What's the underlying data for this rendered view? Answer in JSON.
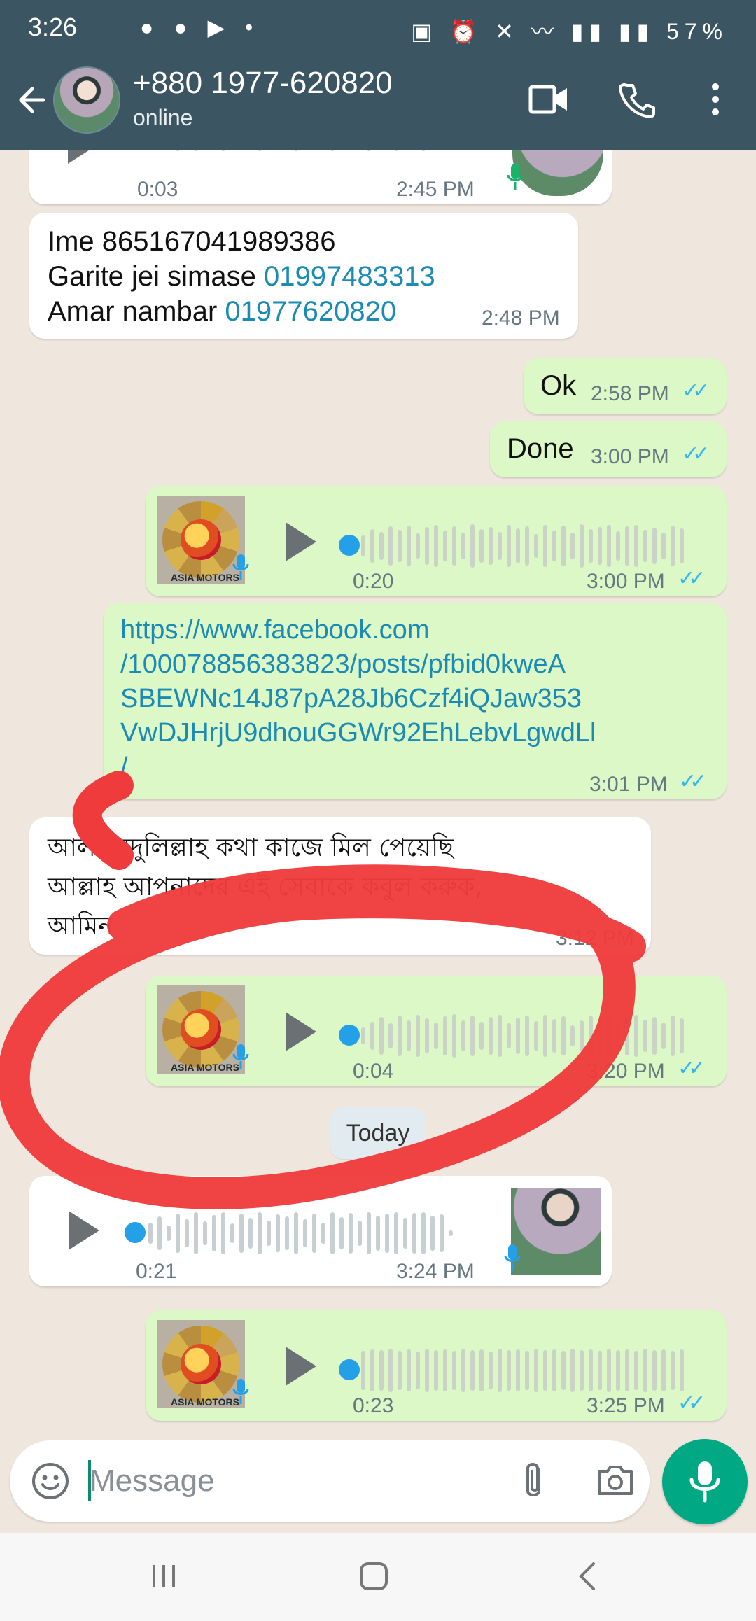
{
  "status_bar": {
    "time": "3:26",
    "battery": "57%"
  },
  "app_bar": {
    "contact_name": "+880 1977-620820",
    "status": "online",
    "icons": [
      "back-arrow-icon",
      "video-call-icon",
      "voice-call-icon",
      "more-options-icon"
    ]
  },
  "messages": {
    "m1_voice_in": {
      "duration": "0:03",
      "time": "2:45 PM"
    },
    "m2_text_in": {
      "line1": "Ime 865167041989386",
      "line2_prefix": "Garite jei simase ",
      "line2_link": "01997483313",
      "line3_prefix": "Amar nambar ",
      "line3_link": "01977620820",
      "time": "2:48 PM"
    },
    "m3_text_out": {
      "text": "Ok",
      "time": "2:58 PM"
    },
    "m4_text_out": {
      "text": "Done",
      "time": "3:00 PM"
    },
    "m5_voice_out": {
      "duration": "0:20",
      "time": "3:00 PM",
      "logo_text": "ASIA MOTORS"
    },
    "m6_link_out": {
      "line1": "https://www.facebook.com",
      "line2": "/100078856383823/posts/pfbid0kweA",
      "line3": "SBEWNc14J87pA28Jb6Czf4iQJaw353",
      "line4": "VwDJHrjU9dhouGGWr92EhLebvLgwdLl",
      "line5": "/",
      "time": "3:01 PM"
    },
    "m7_text_in": {
      "line1": "আলহামদুলিল্লাহ কথা কাজে মিল পেয়েছি",
      "line2": "আল্লাহ আপনাদের এই সেবাকে কবুল করুক,",
      "line3": "আমিন",
      "time": "3:12 PM"
    },
    "m8_voice_out": {
      "duration": "0:04",
      "time": "3:20 PM",
      "logo_text": "ASIA MOTORS"
    },
    "date_chip": "Today",
    "m9_voice_in": {
      "duration": "0:21",
      "time": "3:24 PM"
    },
    "m10_voice_out": {
      "duration": "0:23",
      "time": "3:25 PM",
      "logo_text": "ASIA MOTORS"
    }
  },
  "composer": {
    "placeholder": "Message",
    "icons": [
      "emoji-icon",
      "attach-icon",
      "camera-icon",
      "microphone-icon"
    ]
  },
  "colors": {
    "header": "#3c5562",
    "chat_bg": "#efe7de",
    "outgoing": "#dcf8c6",
    "incoming": "#ffffff",
    "link": "#1b8bb5",
    "ticks": "#34b7f1",
    "accent": "#00a884",
    "annotation": "#ef3b3b"
  }
}
